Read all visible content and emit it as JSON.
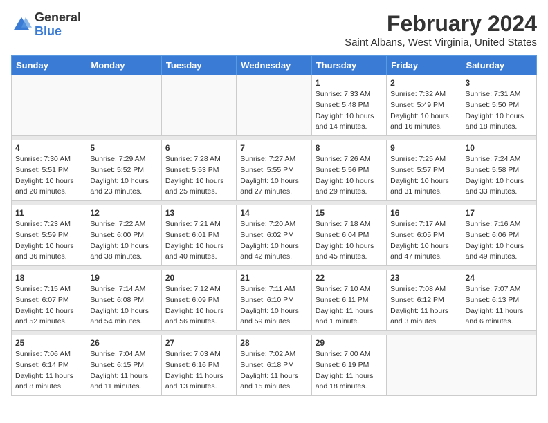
{
  "header": {
    "logo_general": "General",
    "logo_blue": "Blue",
    "main_title": "February 2024",
    "subtitle": "Saint Albans, West Virginia, United States"
  },
  "days_of_week": [
    "Sunday",
    "Monday",
    "Tuesday",
    "Wednesday",
    "Thursday",
    "Friday",
    "Saturday"
  ],
  "weeks": [
    [
      {
        "day": "",
        "info": ""
      },
      {
        "day": "",
        "info": ""
      },
      {
        "day": "",
        "info": ""
      },
      {
        "day": "",
        "info": ""
      },
      {
        "day": "1",
        "info": "Sunrise: 7:33 AM\nSunset: 5:48 PM\nDaylight: 10 hours\nand 14 minutes."
      },
      {
        "day": "2",
        "info": "Sunrise: 7:32 AM\nSunset: 5:49 PM\nDaylight: 10 hours\nand 16 minutes."
      },
      {
        "day": "3",
        "info": "Sunrise: 7:31 AM\nSunset: 5:50 PM\nDaylight: 10 hours\nand 18 minutes."
      }
    ],
    [
      {
        "day": "4",
        "info": "Sunrise: 7:30 AM\nSunset: 5:51 PM\nDaylight: 10 hours\nand 20 minutes."
      },
      {
        "day": "5",
        "info": "Sunrise: 7:29 AM\nSunset: 5:52 PM\nDaylight: 10 hours\nand 23 minutes."
      },
      {
        "day": "6",
        "info": "Sunrise: 7:28 AM\nSunset: 5:53 PM\nDaylight: 10 hours\nand 25 minutes."
      },
      {
        "day": "7",
        "info": "Sunrise: 7:27 AM\nSunset: 5:55 PM\nDaylight: 10 hours\nand 27 minutes."
      },
      {
        "day": "8",
        "info": "Sunrise: 7:26 AM\nSunset: 5:56 PM\nDaylight: 10 hours\nand 29 minutes."
      },
      {
        "day": "9",
        "info": "Sunrise: 7:25 AM\nSunset: 5:57 PM\nDaylight: 10 hours\nand 31 minutes."
      },
      {
        "day": "10",
        "info": "Sunrise: 7:24 AM\nSunset: 5:58 PM\nDaylight: 10 hours\nand 33 minutes."
      }
    ],
    [
      {
        "day": "11",
        "info": "Sunrise: 7:23 AM\nSunset: 5:59 PM\nDaylight: 10 hours\nand 36 minutes."
      },
      {
        "day": "12",
        "info": "Sunrise: 7:22 AM\nSunset: 6:00 PM\nDaylight: 10 hours\nand 38 minutes."
      },
      {
        "day": "13",
        "info": "Sunrise: 7:21 AM\nSunset: 6:01 PM\nDaylight: 10 hours\nand 40 minutes."
      },
      {
        "day": "14",
        "info": "Sunrise: 7:20 AM\nSunset: 6:02 PM\nDaylight: 10 hours\nand 42 minutes."
      },
      {
        "day": "15",
        "info": "Sunrise: 7:18 AM\nSunset: 6:04 PM\nDaylight: 10 hours\nand 45 minutes."
      },
      {
        "day": "16",
        "info": "Sunrise: 7:17 AM\nSunset: 6:05 PM\nDaylight: 10 hours\nand 47 minutes."
      },
      {
        "day": "17",
        "info": "Sunrise: 7:16 AM\nSunset: 6:06 PM\nDaylight: 10 hours\nand 49 minutes."
      }
    ],
    [
      {
        "day": "18",
        "info": "Sunrise: 7:15 AM\nSunset: 6:07 PM\nDaylight: 10 hours\nand 52 minutes."
      },
      {
        "day": "19",
        "info": "Sunrise: 7:14 AM\nSunset: 6:08 PM\nDaylight: 10 hours\nand 54 minutes."
      },
      {
        "day": "20",
        "info": "Sunrise: 7:12 AM\nSunset: 6:09 PM\nDaylight: 10 hours\nand 56 minutes."
      },
      {
        "day": "21",
        "info": "Sunrise: 7:11 AM\nSunset: 6:10 PM\nDaylight: 10 hours\nand 59 minutes."
      },
      {
        "day": "22",
        "info": "Sunrise: 7:10 AM\nSunset: 6:11 PM\nDaylight: 11 hours\nand 1 minute."
      },
      {
        "day": "23",
        "info": "Sunrise: 7:08 AM\nSunset: 6:12 PM\nDaylight: 11 hours\nand 3 minutes."
      },
      {
        "day": "24",
        "info": "Sunrise: 7:07 AM\nSunset: 6:13 PM\nDaylight: 11 hours\nand 6 minutes."
      }
    ],
    [
      {
        "day": "25",
        "info": "Sunrise: 7:06 AM\nSunset: 6:14 PM\nDaylight: 11 hours\nand 8 minutes."
      },
      {
        "day": "26",
        "info": "Sunrise: 7:04 AM\nSunset: 6:15 PM\nDaylight: 11 hours\nand 11 minutes."
      },
      {
        "day": "27",
        "info": "Sunrise: 7:03 AM\nSunset: 6:16 PM\nDaylight: 11 hours\nand 13 minutes."
      },
      {
        "day": "28",
        "info": "Sunrise: 7:02 AM\nSunset: 6:18 PM\nDaylight: 11 hours\nand 15 minutes."
      },
      {
        "day": "29",
        "info": "Sunrise: 7:00 AM\nSunset: 6:19 PM\nDaylight: 11 hours\nand 18 minutes."
      },
      {
        "day": "",
        "info": ""
      },
      {
        "day": "",
        "info": ""
      }
    ]
  ]
}
